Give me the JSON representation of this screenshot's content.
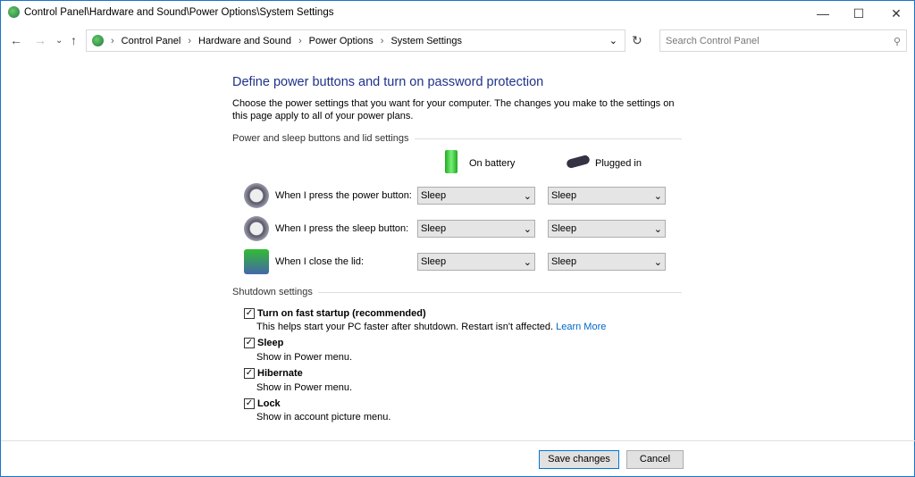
{
  "window": {
    "title": "Control Panel\\Hardware and Sound\\Power Options\\System Settings"
  },
  "address": {
    "crumbs": [
      "Control Panel",
      "Hardware and Sound",
      "Power Options",
      "System Settings"
    ]
  },
  "search": {
    "placeholder": "Search Control Panel"
  },
  "main": {
    "title": "Define power buttons and turn on password protection",
    "description": "Choose the power settings that you want for your computer. The changes you make to the settings on this page apply to all of your power plans.",
    "section1": "Power and sleep buttons and lid settings",
    "col_battery": "On battery",
    "col_plugged": "Plugged in",
    "rows": [
      {
        "label": "When I press the power button:",
        "battery": "Sleep",
        "plugged": "Sleep",
        "icon": "power-button-icon"
      },
      {
        "label": "When I press the sleep button:",
        "battery": "Sleep",
        "plugged": "Sleep",
        "icon": "sleep-button-icon"
      },
      {
        "label": "When I close the lid:",
        "battery": "Sleep",
        "plugged": "Sleep",
        "icon": "laptop-lid-icon"
      }
    ],
    "section2": "Shutdown settings",
    "options": [
      {
        "label": "Turn on fast startup (recommended)",
        "desc": "This helps start your PC faster after shutdown. Restart isn't affected. ",
        "link": "Learn More",
        "checked": true
      },
      {
        "label": "Sleep",
        "desc": "Show in Power menu.",
        "checked": true
      },
      {
        "label": "Hibernate",
        "desc": "Show in Power menu.",
        "checked": true
      },
      {
        "label": "Lock",
        "desc": "Show in account picture menu.",
        "checked": true
      }
    ]
  },
  "footer": {
    "save": "Save changes",
    "cancel": "Cancel"
  }
}
